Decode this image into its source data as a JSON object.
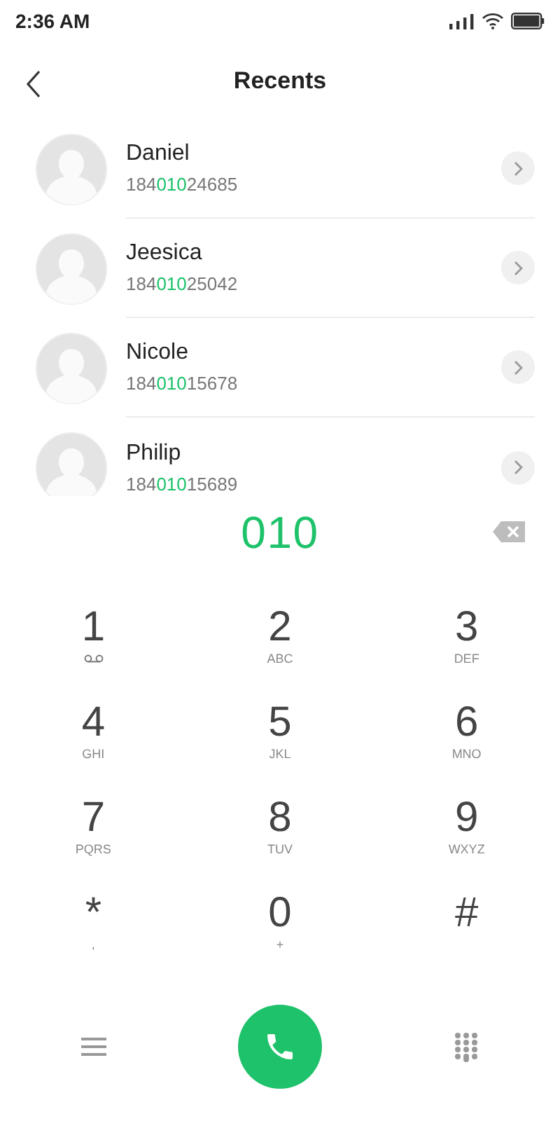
{
  "status_bar": {
    "time": "2:36 AM"
  },
  "header": {
    "title": "Recents"
  },
  "contacts": [
    {
      "name": "Daniel",
      "number": {
        "before": "184",
        "match": "010",
        "after": "24685"
      }
    },
    {
      "name": "Jeesica",
      "number": {
        "before": "184",
        "match": "010",
        "after": "25042"
      }
    },
    {
      "name": "Nicole",
      "number": {
        "before": "184",
        "match": "010",
        "after": "15678"
      }
    },
    {
      "name": "Philip",
      "number": {
        "before": "184",
        "match": "010",
        "after": "15689"
      }
    }
  ],
  "dialed": "010",
  "keys": [
    {
      "digit": "1",
      "kind": "voicemail"
    },
    {
      "digit": "2",
      "kind": "letters",
      "letters": "ABC"
    },
    {
      "digit": "3",
      "kind": "letters",
      "letters": "DEF"
    },
    {
      "digit": "4",
      "kind": "letters",
      "letters": "GHI"
    },
    {
      "digit": "5",
      "kind": "letters",
      "letters": "JKL"
    },
    {
      "digit": "6",
      "kind": "letters",
      "letters": "MNO"
    },
    {
      "digit": "7",
      "kind": "letters",
      "letters": "PQRS"
    },
    {
      "digit": "8",
      "kind": "letters",
      "letters": "TUV"
    },
    {
      "digit": "9",
      "kind": "letters",
      "letters": "WXYZ"
    },
    {
      "digit": "*",
      "kind": "letters",
      "letters": ","
    },
    {
      "digit": "0",
      "kind": "letters",
      "letters": "+"
    },
    {
      "digit": "#",
      "kind": "plain"
    }
  ]
}
